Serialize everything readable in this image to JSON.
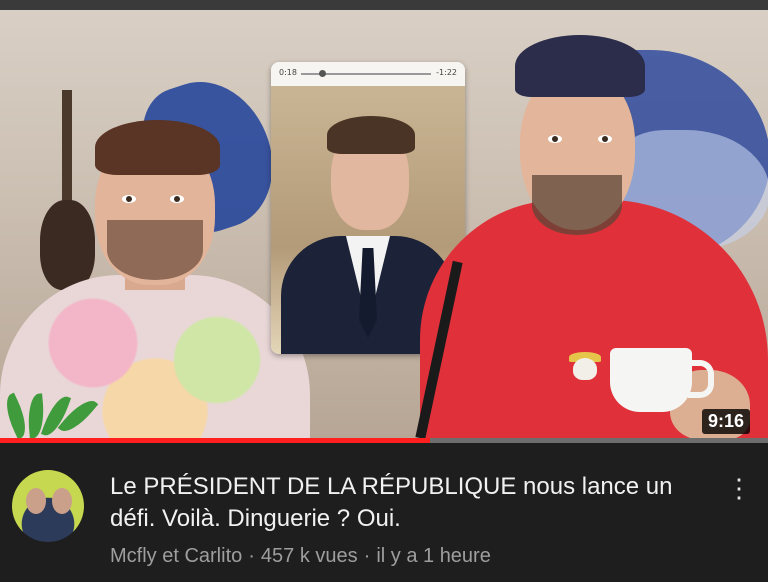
{
  "video": {
    "duration": "9:16",
    "watched_fraction": 0.56,
    "inset_player": {
      "time_elapsed": "0:18",
      "time_remaining": "-1:22"
    }
  },
  "details": {
    "title": "Le PRÉSIDENT DE LA RÉPUBLIQUE nous lance un défi. Voilà. Dinguerie ? Oui.",
    "channel": "Mcfly et Carlito",
    "separator": "·",
    "views": "457 k vues",
    "age": "il y a 1 heure",
    "more_icon": "⋮"
  },
  "colors": {
    "progress_fill": "#ff1f1f",
    "background": "#1e1e1e",
    "title_text": "#f1f1f1",
    "meta_text": "#9e9e9e"
  },
  "icons": {
    "more": "vertical-ellipsis-icon",
    "avatar": "channel-avatar"
  }
}
